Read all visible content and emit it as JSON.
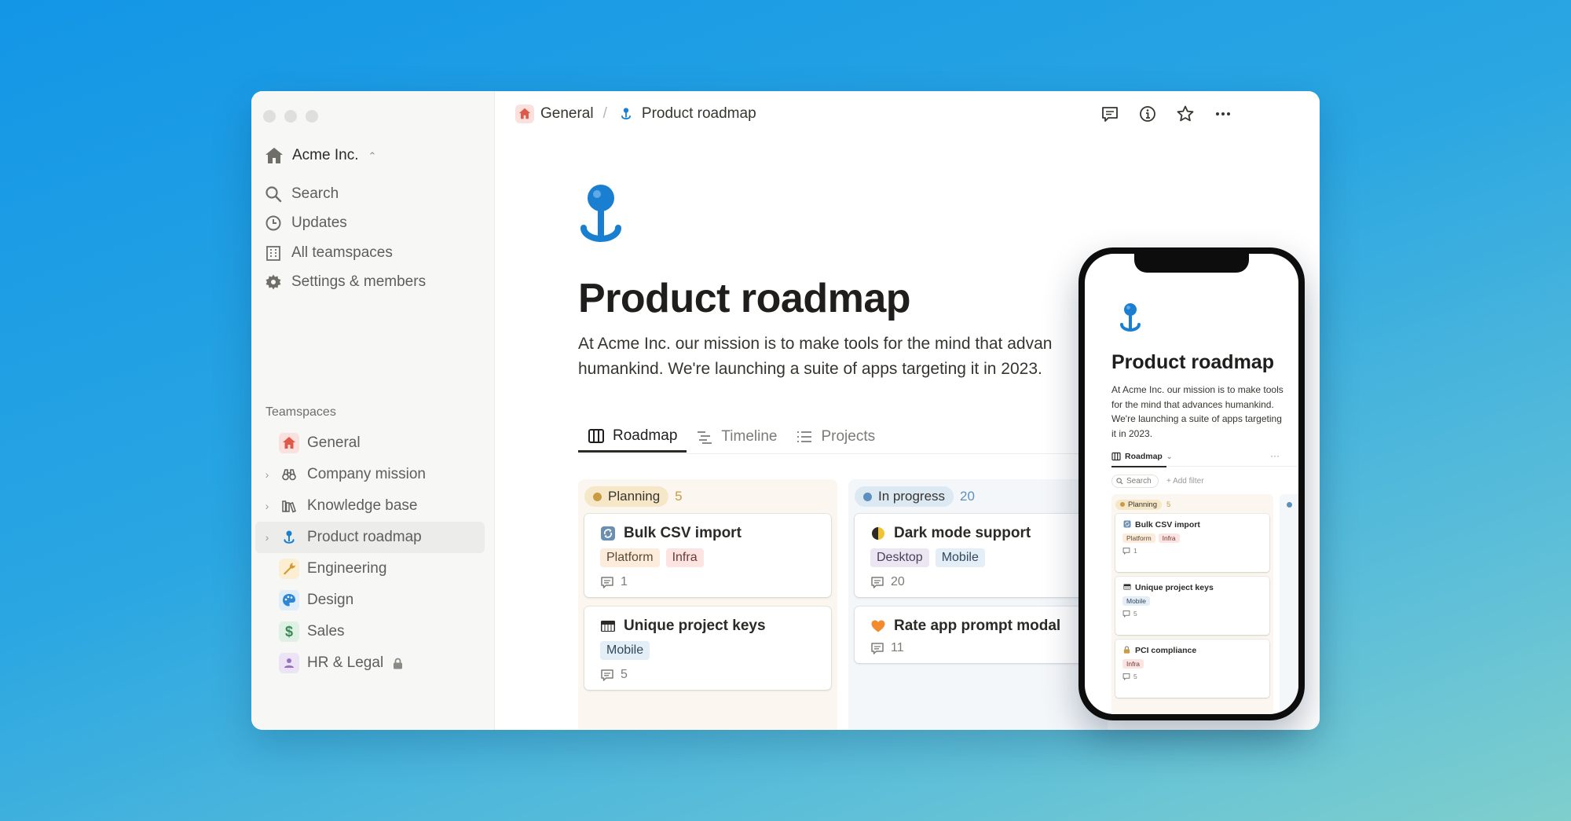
{
  "sidebar": {
    "workspace": "Acme Inc.",
    "nav": [
      {
        "label": "Search",
        "icon": "search-icon"
      },
      {
        "label": "Updates",
        "icon": "clock-icon"
      },
      {
        "label": "All teamspaces",
        "icon": "building-icon"
      },
      {
        "label": "Settings & members",
        "icon": "gear-icon"
      }
    ],
    "teamspaces_label": "Teamspaces",
    "teamspaces": [
      {
        "label": "General",
        "icon": "house-icon"
      },
      {
        "label": "Company mission",
        "icon": "binoculars-icon"
      },
      {
        "label": "Knowledge base",
        "icon": "books-icon"
      },
      {
        "label": "Product roadmap",
        "icon": "roadmap-pin-icon"
      },
      {
        "label": "Engineering",
        "icon": "wrench-icon"
      },
      {
        "label": "Design",
        "icon": "palette-icon"
      },
      {
        "label": "Sales",
        "icon": "dollar-icon"
      },
      {
        "label": "HR & Legal",
        "icon": "person-icon"
      }
    ]
  },
  "breadcrumb": {
    "parent": "General",
    "separator": "/",
    "current": "Product roadmap"
  },
  "page": {
    "title": "Product roadmap",
    "description": "At Acme Inc. our mission is to make tools for the mind that advan\nhumankind. We're launching a suite of apps targeting it in 2023."
  },
  "tabs": [
    {
      "label": "Roadmap",
      "icon": "board-icon"
    },
    {
      "label": "Timeline",
      "icon": "timeline-icon"
    },
    {
      "label": "Projects",
      "icon": "list-icon"
    }
  ],
  "board": {
    "columns": [
      {
        "name": "Planning",
        "count": "5",
        "cards": [
          {
            "title": "Bulk CSV import",
            "icon": "sync-icon",
            "tags": [
              "Platform",
              "Infra"
            ],
            "comments": "1"
          },
          {
            "title": "Unique project keys",
            "icon": "piano-icon",
            "tags": [
              "Mobile"
            ],
            "comments": "5"
          }
        ]
      },
      {
        "name": "In progress",
        "count": "20",
        "cards": [
          {
            "title": "Dark mode support",
            "icon": "half-moon-icon",
            "tags": [
              "Desktop",
              "Mobile"
            ],
            "comments": "20"
          },
          {
            "title": "Rate app prompt modal",
            "icon": "heart-icon",
            "tags": [],
            "comments": "11"
          }
        ]
      }
    ]
  },
  "phone": {
    "title": "Product roadmap",
    "description": "At Acme Inc. our mission is to make tools for the mind that advances humankind. We're launching a suite of apps targeting it in 2023.",
    "view": "Roadmap",
    "more": "···",
    "search": "Search",
    "filter": "+ Add filter",
    "column": {
      "name": "Planning",
      "count": "5"
    },
    "cards": [
      {
        "title": "Bulk CSV import",
        "icon": "sync-icon",
        "tags": [
          "Platform",
          "Infra"
        ],
        "comments": "1"
      },
      {
        "title": "Unique project keys",
        "icon": "piano-icon",
        "tags": [
          "Mobile"
        ],
        "comments": "5"
      },
      {
        "title": "PCI compliance",
        "icon": "lock-icon",
        "tags": [
          "Infra"
        ],
        "comments": "5"
      }
    ]
  },
  "colors": {
    "accent_blue": "#1a7fd1",
    "planning": "#c99b45",
    "progress": "#5d8fbf"
  }
}
